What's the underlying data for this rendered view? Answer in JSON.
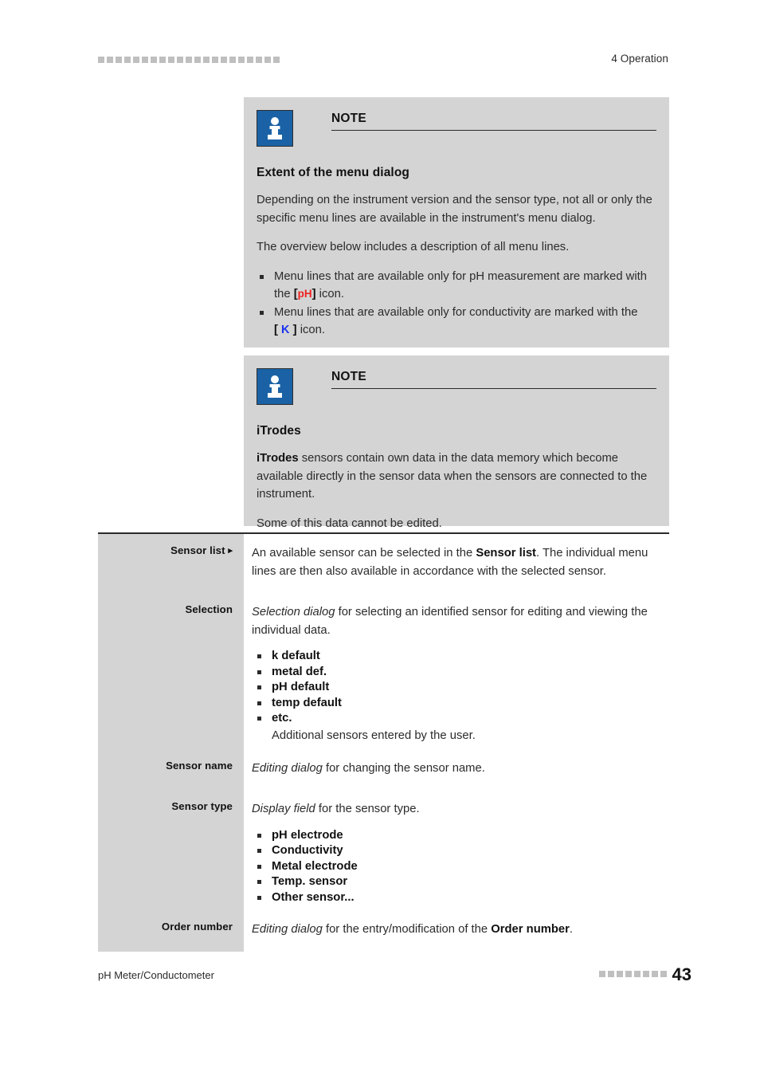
{
  "header": {
    "decoration_squares": 21,
    "title": "4 Operation"
  },
  "notes": [
    {
      "icon": "info-icon",
      "label": "NOTE",
      "heading": "Extent of the menu dialog",
      "paragraphs": [
        "Depending on the instrument version and the sensor type, not all or only the specific menu lines are available in the instrument's menu dialog.",
        "The overview below includes a description of all menu lines."
      ],
      "bullets": [
        {
          "before": "Menu lines that are available only for pH measurement are marked with the ",
          "tag": "pH",
          "tag_color": "#ee2222",
          "after": " icon."
        },
        {
          "before": "Menu lines that are available only for conductivity are marked with the ",
          "tag": "K",
          "tag_color": "#1a33ee",
          "after": " icon."
        }
      ]
    },
    {
      "icon": "info-icon",
      "label": "NOTE",
      "heading": "iTrodes",
      "paragraphs": [
        "iTrodes sensors contain own data in the data memory which become available directly in the sensor data when the sensors are connected to the instrument.",
        "Some of this data cannot be edited."
      ],
      "bold_lead": "iTrodes"
    }
  ],
  "table": {
    "rows": [
      {
        "label": "Sensor list",
        "has_arrow": true,
        "arrow_glyph": "▸",
        "text_before_bold": "An available sensor can be selected in the ",
        "bold_term": "Sensor list",
        "text_after_bold": ". The individual menu lines are then also available in accordance with the selected sensor.",
        "items": []
      },
      {
        "label": "Selection",
        "has_arrow": false,
        "italic_lead": "Selection dialog",
        "text_after_italic": " for selecting an identified sensor for editing and viewing the individual data.",
        "items": [
          {
            "text": "k default"
          },
          {
            "text": "metal def."
          },
          {
            "text": "pH default"
          },
          {
            "text": "temp default"
          },
          {
            "text": "etc.",
            "sub": "Additional sensors entered by the user."
          }
        ]
      },
      {
        "label": "Sensor name",
        "has_arrow": false,
        "italic_lead": "Editing dialog",
        "text_after_italic": " for changing the sensor name.",
        "items": []
      },
      {
        "label": "Sensor type",
        "has_arrow": false,
        "italic_lead": "Display field",
        "text_after_italic": " for the sensor type.",
        "items": [
          {
            "text": "pH electrode"
          },
          {
            "text": "Conductivity"
          },
          {
            "text": "Metal electrode"
          },
          {
            "text": "Temp. sensor"
          },
          {
            "text": "Other sensor..."
          }
        ]
      },
      {
        "label": "Order number",
        "has_arrow": false,
        "italic_lead": "Editing dialog",
        "text_after_italic": " for the entry/modification of the ",
        "bold_tail": "Order number",
        "text_end": ".",
        "items": []
      }
    ]
  },
  "footer": {
    "left": "pH Meter/Conductometer",
    "decoration_squares": 8,
    "page_number": "43"
  },
  "colors": {
    "note_background": "#d4d4d4",
    "info_icon_blue": "#1a62a5",
    "ph_tag": "#ee2222",
    "k_tag": "#1a33ee",
    "rule": "#2a2a2a",
    "decoration_square": "#bfbfbf"
  }
}
